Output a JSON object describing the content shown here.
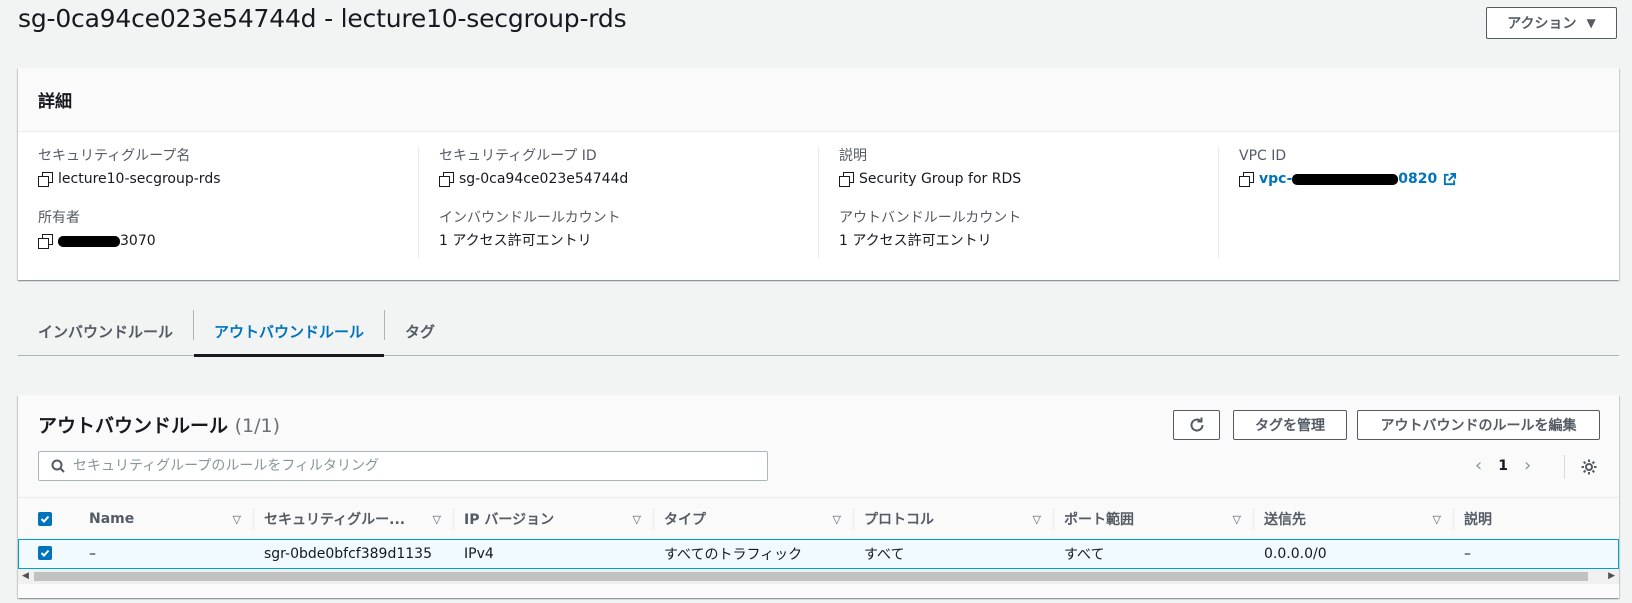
{
  "header": {
    "title": "sg-0ca94ce023e54744d - lecture10-secgroup-rds",
    "actions_label": "アクション"
  },
  "details": {
    "heading": "詳細",
    "fields": {
      "name_label": "セキュリティグループ名",
      "name_value": "lecture10-secgroup-rds",
      "id_label": "セキュリティグループ ID",
      "id_value": "sg-0ca94ce023e54744d",
      "desc_label": "説明",
      "desc_value": "Security Group for RDS",
      "vpc_label": "VPC ID",
      "vpc_value_prefix": "vpc-",
      "vpc_value_suffix": "0820",
      "owner_label": "所有者",
      "owner_value_suffix": "3070",
      "inbound_count_label": "インバウンドルールカウント",
      "inbound_count_value": "1 アクセス許可エントリ",
      "outbound_count_label": "アウトバンドルールカウント",
      "outbound_count_value": "1 アクセス許可エントリ"
    }
  },
  "tabs": [
    {
      "label": "インバウンドルール",
      "active": false
    },
    {
      "label": "アウトバウンドルール",
      "active": true
    },
    {
      "label": "タグ",
      "active": false
    }
  ],
  "rules": {
    "title": "アウトバウンドルール",
    "count": "(1/1)",
    "manage_tags_label": "タグを管理",
    "edit_label": "アウトバウンドのルールを編集",
    "search_placeholder": "セキュリティグループのルールをフィルタリング",
    "page_number": "1",
    "columns": [
      "Name",
      "セキュリティグルー...",
      "IP バージョン",
      "タイプ",
      "プロトコル",
      "ポート範囲",
      "送信先",
      "説明"
    ],
    "rows": [
      [
        "–",
        "sgr-0bde0bfcf389d1135",
        "IPv4",
        "すべてのトラフィック",
        "すべて",
        "すべて",
        "0.0.0.0/0",
        "–"
      ]
    ]
  },
  "colors": {
    "accent": "#0073bb",
    "background": "#f2f3f3",
    "selected_row": "#f1faff"
  }
}
